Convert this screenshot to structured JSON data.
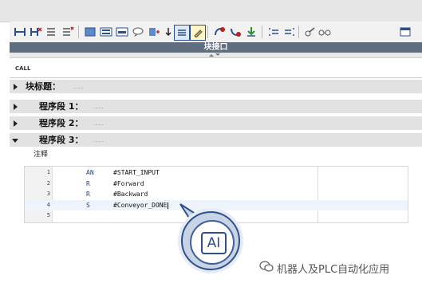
{
  "toolbar": {
    "icons": [
      "ladder-icon",
      "ladder-delete-icon",
      "insert-network-icon",
      "delete-network-icon",
      "block-icon",
      "monitor-icon",
      "comment-icon",
      "insert-instruction-icon",
      "list-icon",
      "highlight-icon",
      "goto-error-icon",
      "goto-next-icon",
      "download-icon",
      "indent-icon",
      "outdent-icon",
      "compare-icon",
      "glasses-icon",
      "window-icon"
    ]
  },
  "title_strip": {
    "label": "块接口"
  },
  "call_label": "CALL",
  "block_title": {
    "label": "块标题：",
    "dots": "....."
  },
  "networks": [
    {
      "label": "程序段 1：",
      "dots": "....."
    },
    {
      "label": "程序段 2：",
      "dots": "....."
    },
    {
      "label": "程序段 3：",
      "dots": "....."
    }
  ],
  "comment_label": "注释",
  "code_lines": [
    {
      "num": "1",
      "op": "AN",
      "operand": "#START_INPUT"
    },
    {
      "num": "2",
      "op": "R",
      "operand": "#Forward"
    },
    {
      "num": "3",
      "op": "R",
      "operand": "#Backward"
    },
    {
      "num": "4",
      "op": "S",
      "operand": "#Conveyor_DONE"
    },
    {
      "num": "5",
      "op": "",
      "operand": ""
    }
  ],
  "callout": {
    "text": "AI"
  },
  "watermark": "机器人及PLC自动化应用"
}
